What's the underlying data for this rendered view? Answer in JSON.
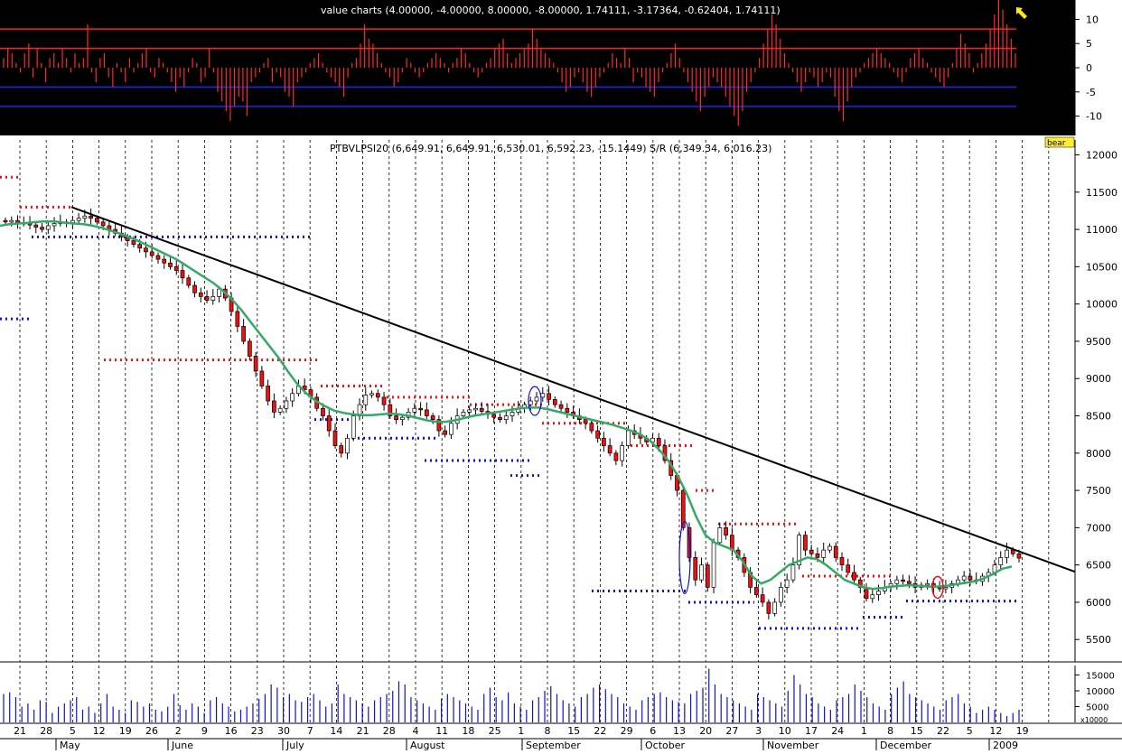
{
  "chart_data": [
    {
      "panel": "indicator",
      "type": "bar",
      "title": "value charts (4.00000, -4.00000, 8.00000, -8.00000, 1.74111, -3.17364, -0.62404, 1.74111)",
      "background": "#000000",
      "ylim": [
        -14,
        14
      ],
      "yticks": [
        10,
        5,
        0,
        -5,
        -10
      ],
      "levels": [
        {
          "value": 8,
          "color": "#ff2020"
        },
        {
          "value": 4,
          "color": "#ff2020"
        },
        {
          "value": -4,
          "color": "#2020ff"
        },
        {
          "value": -8,
          "color": "#2020ff"
        }
      ],
      "bar_color": "#ff2a2a",
      "marker": {
        "type": "arrow",
        "color": "#ffee00",
        "position_index": 220
      },
      "values": [
        2,
        4,
        3,
        1,
        -1,
        3,
        5,
        -2,
        4,
        1,
        -3,
        2,
        3,
        1,
        4,
        2,
        -1,
        3,
        1,
        2,
        9,
        -1,
        -3,
        2,
        3,
        -2,
        -4,
        1,
        -1,
        -3,
        2,
        -1,
        1,
        3,
        4,
        -1,
        -2,
        2,
        1,
        -1,
        -3,
        -5,
        -2,
        -4,
        -1,
        2,
        1,
        -3,
        -2,
        4,
        -1,
        -5,
        -7,
        -9,
        -11,
        -8,
        -6,
        -7,
        -10,
        -3,
        -2,
        -1,
        1,
        2,
        -3,
        -1,
        -2,
        -5,
        -6,
        -8,
        -3,
        -2,
        -1,
        1,
        2,
        3,
        1,
        -1,
        -2,
        -3,
        -4,
        -6,
        -2,
        1,
        2,
        5,
        9,
        6,
        5,
        3,
        1,
        -1,
        -2,
        -4,
        -3,
        -1,
        2,
        1,
        -1,
        -2,
        -1,
        1,
        2,
        3,
        2,
        1,
        -1,
        1,
        2,
        4,
        3,
        1,
        -1,
        -2,
        -1,
        1,
        2,
        4,
        5,
        6,
        3,
        1,
        2,
        3,
        4,
        5,
        8,
        6,
        4,
        3,
        2,
        1,
        -1,
        -3,
        -5,
        -4,
        -2,
        -1,
        -3,
        -5,
        -6,
        -4,
        -2,
        -1,
        1,
        3,
        2,
        1,
        4,
        2,
        -3,
        -1,
        -2,
        -4,
        -5,
        -6,
        -3,
        -1,
        1,
        3,
        5,
        2,
        -1,
        -3,
        -5,
        -7,
        -9,
        -6,
        -4,
        -2,
        -3,
        -4,
        -6,
        -8,
        -10,
        -12,
        -9,
        -5,
        -3,
        -1,
        2,
        5,
        8,
        11,
        9,
        6,
        3,
        1,
        -1,
        -3,
        -5,
        -3,
        -1,
        -2,
        -4,
        -3,
        -1,
        -2,
        -6,
        -9,
        -11,
        -7,
        -4,
        -2,
        -1,
        1,
        2,
        3,
        4,
        3,
        2,
        1,
        -1,
        -2,
        -3,
        -1,
        2,
        3,
        4,
        2,
        1,
        -1,
        -2,
        -3,
        -4,
        -2,
        1,
        4,
        7,
        5,
        3,
        -1,
        1,
        3,
        5,
        8,
        11,
        14,
        12,
        9,
        6,
        3
      ]
    },
    {
      "panel": "price",
      "type": "candlestick",
      "title": "PTBVLPSI20 (6,649.91, 6,649.91, 6,530.01, 6,592.23, -15.1449) S/R (6,349.34, 6,016.23)",
      "badge": "bear",
      "ylabel": "",
      "ylim": [
        5200,
        12200
      ],
      "yticks": [
        12000,
        11500,
        11000,
        10500,
        10000,
        9500,
        9000,
        8500,
        8000,
        7500,
        7000,
        6500,
        6000,
        5500
      ],
      "colors": {
        "up": "#ffffff",
        "down": "#ee1111",
        "ma": "#33aa66",
        "trend": "#000000",
        "resistance": "#ee1111",
        "support": "#1111cc"
      },
      "closes": [
        11100,
        11120,
        11090,
        11080,
        11060,
        11030,
        11000,
        11050,
        11080,
        11100,
        11090,
        11120,
        11150,
        11180,
        11150,
        11100,
        11050,
        11000,
        10950,
        10900,
        10850,
        10800,
        10750,
        10700,
        10650,
        10600,
        10550,
        10500,
        10450,
        10350,
        10250,
        10150,
        10100,
        10050,
        10100,
        10200,
        10080,
        9900,
        9700,
        9500,
        9300,
        9100,
        8900,
        8700,
        8550,
        8600,
        8700,
        8800,
        8900,
        8850,
        8750,
        8600,
        8500,
        8300,
        8100,
        8000,
        8200,
        8500,
        8650,
        8780,
        8800,
        8750,
        8650,
        8500,
        8450,
        8480,
        8550,
        8600,
        8580,
        8500,
        8450,
        8300,
        8250,
        8400,
        8500,
        8550,
        8580,
        8600,
        8560,
        8520,
        8480,
        8450,
        8500,
        8550,
        8600,
        8650,
        8700,
        8750,
        8800,
        8720,
        8650,
        8600,
        8550,
        8500,
        8450,
        8400,
        8300,
        8200,
        8100,
        8000,
        7900,
        8100,
        8300,
        8250,
        8200,
        8150,
        8200,
        8100,
        7900,
        7700,
        7500,
        7000,
        6600,
        6300,
        6500,
        6200,
        6800,
        7000,
        6900,
        6700,
        6600,
        6400,
        6200,
        6100,
        6000,
        5850,
        6000,
        6200,
        6300,
        6500,
        6900,
        6700,
        6650,
        6600,
        6700,
        6750,
        6600,
        6500,
        6400,
        6300,
        6200,
        6050,
        6100,
        6150,
        6200,
        6250,
        6300,
        6280,
        6250,
        6200,
        6230,
        6250,
        6200,
        6180,
        6200,
        6250,
        6300,
        6350,
        6300,
        6280,
        6350,
        6400,
        6500,
        6600,
        6700,
        6650,
        6592
      ],
      "moving_average": [
        11050,
        11070,
        11080,
        11090,
        11100,
        11110,
        11105,
        11090,
        11080,
        11070,
        11050,
        11020,
        10980,
        10940,
        10890,
        10840,
        10780,
        10720,
        10660,
        10600,
        10520,
        10440,
        10360,
        10280,
        10180,
        10060,
        9920,
        9760,
        9600,
        9440,
        9280,
        9100,
        8930,
        8800,
        8700,
        8630,
        8570,
        8540,
        8520,
        8510,
        8510,
        8520,
        8530,
        8520,
        8500,
        8470,
        8440,
        8420,
        8420,
        8440,
        8470,
        8500,
        8520,
        8540,
        8560,
        8580,
        8600,
        8610,
        8610,
        8590,
        8560,
        8530,
        8500,
        8470,
        8440,
        8410,
        8380,
        8340,
        8300,
        8250,
        8170,
        8050,
        7900,
        7700,
        7450,
        7150,
        6900,
        6800,
        6750,
        6700,
        6550,
        6350,
        6250,
        6300,
        6400,
        6500,
        6550,
        6600,
        6580,
        6500,
        6400,
        6300,
        6250,
        6200,
        6180,
        6190,
        6210,
        6220,
        6230,
        6220,
        6210,
        6210,
        6220,
        6240,
        6260,
        6280,
        6320,
        6380,
        6450,
        6480
      ],
      "trendline": {
        "start": [
          "May 5",
          11300
        ],
        "end": [
          "Jan 19",
          6400
        ]
      },
      "resistance_levels": [
        11700,
        11300,
        9250,
        8900,
        8750,
        8650,
        8400,
        8100,
        7500,
        7050,
        6350
      ],
      "support_levels": [
        9800,
        10900,
        8450,
        8200,
        7900,
        7700,
        6150,
        6000,
        5650,
        5800,
        6016
      ]
    },
    {
      "panel": "volume",
      "type": "bar",
      "bar_color": "#1111cc",
      "ylim": [
        0,
        18000
      ],
      "yticks": [
        15000,
        10000,
        5000
      ],
      "multiplier_label": "x10000",
      "values": [
        9000,
        9500,
        8000,
        5000,
        6000,
        4000,
        7000,
        6500,
        3000,
        5000,
        6000,
        7000,
        8000,
        4000,
        5000,
        3000,
        6000,
        9000,
        5000,
        4000,
        3000,
        7000,
        6500,
        5000,
        6000,
        4000,
        3500,
        5000,
        9000,
        5500,
        4000,
        6000,
        5000,
        3000,
        7000,
        8000,
        6000,
        5000,
        3500,
        4000,
        5000,
        6000,
        7500,
        9000,
        12000,
        11000,
        8000,
        9000,
        7000,
        6500,
        8000,
        9000,
        7000,
        5000,
        6000,
        12000,
        9000,
        8000,
        7000,
        6000,
        5000,
        7000,
        8000,
        9000,
        10000,
        13000,
        12000,
        8000,
        7000,
        6000,
        5000,
        4000,
        7500,
        9000,
        8000,
        7000,
        6000,
        5000,
        4000,
        9000,
        11000,
        8000,
        7000,
        9500,
        6000,
        5000,
        4000,
        7000,
        8000,
        10000,
        11500,
        9000,
        7000,
        6000,
        5000,
        8000,
        9000,
        11000,
        12000,
        10500,
        9000,
        8000,
        6000,
        5000,
        4000,
        7000,
        8000,
        9000,
        9500,
        8000,
        7000,
        6500,
        6000,
        9000,
        10000,
        11000,
        17000,
        12000,
        9000,
        8000,
        7000,
        6000,
        5000,
        4000,
        9000,
        8000,
        7000,
        6000,
        5000,
        10000,
        15000,
        12000,
        9000,
        8000,
        6000,
        5000,
        4000,
        7000,
        8000,
        9000,
        12000,
        10000,
        8000,
        6000,
        5000,
        4000,
        9000,
        11000,
        13000,
        9000,
        8000,
        7000,
        6000,
        5000,
        4000,
        7000,
        8000,
        9000,
        6000,
        5000,
        3000,
        4000,
        5000,
        4000,
        3000,
        2000,
        3000,
        4000
      ]
    }
  ],
  "x_axis": {
    "day_labels": [
      "21",
      "28",
      "5",
      "12",
      "19",
      "26",
      "2",
      "9",
      "16",
      "23",
      "30",
      "7",
      "14",
      "21",
      "28",
      "4",
      "11",
      "18",
      "25",
      "1",
      "8",
      "15",
      "22",
      "29",
      "6",
      "13",
      "20",
      "27",
      "3",
      "10",
      "17",
      "24",
      "1",
      "8",
      "15",
      "22",
      "5",
      "12",
      "19"
    ],
    "month_labels": [
      "May",
      "June",
      "July",
      "August",
      "September",
      "October",
      "November",
      "December",
      "2009"
    ]
  }
}
